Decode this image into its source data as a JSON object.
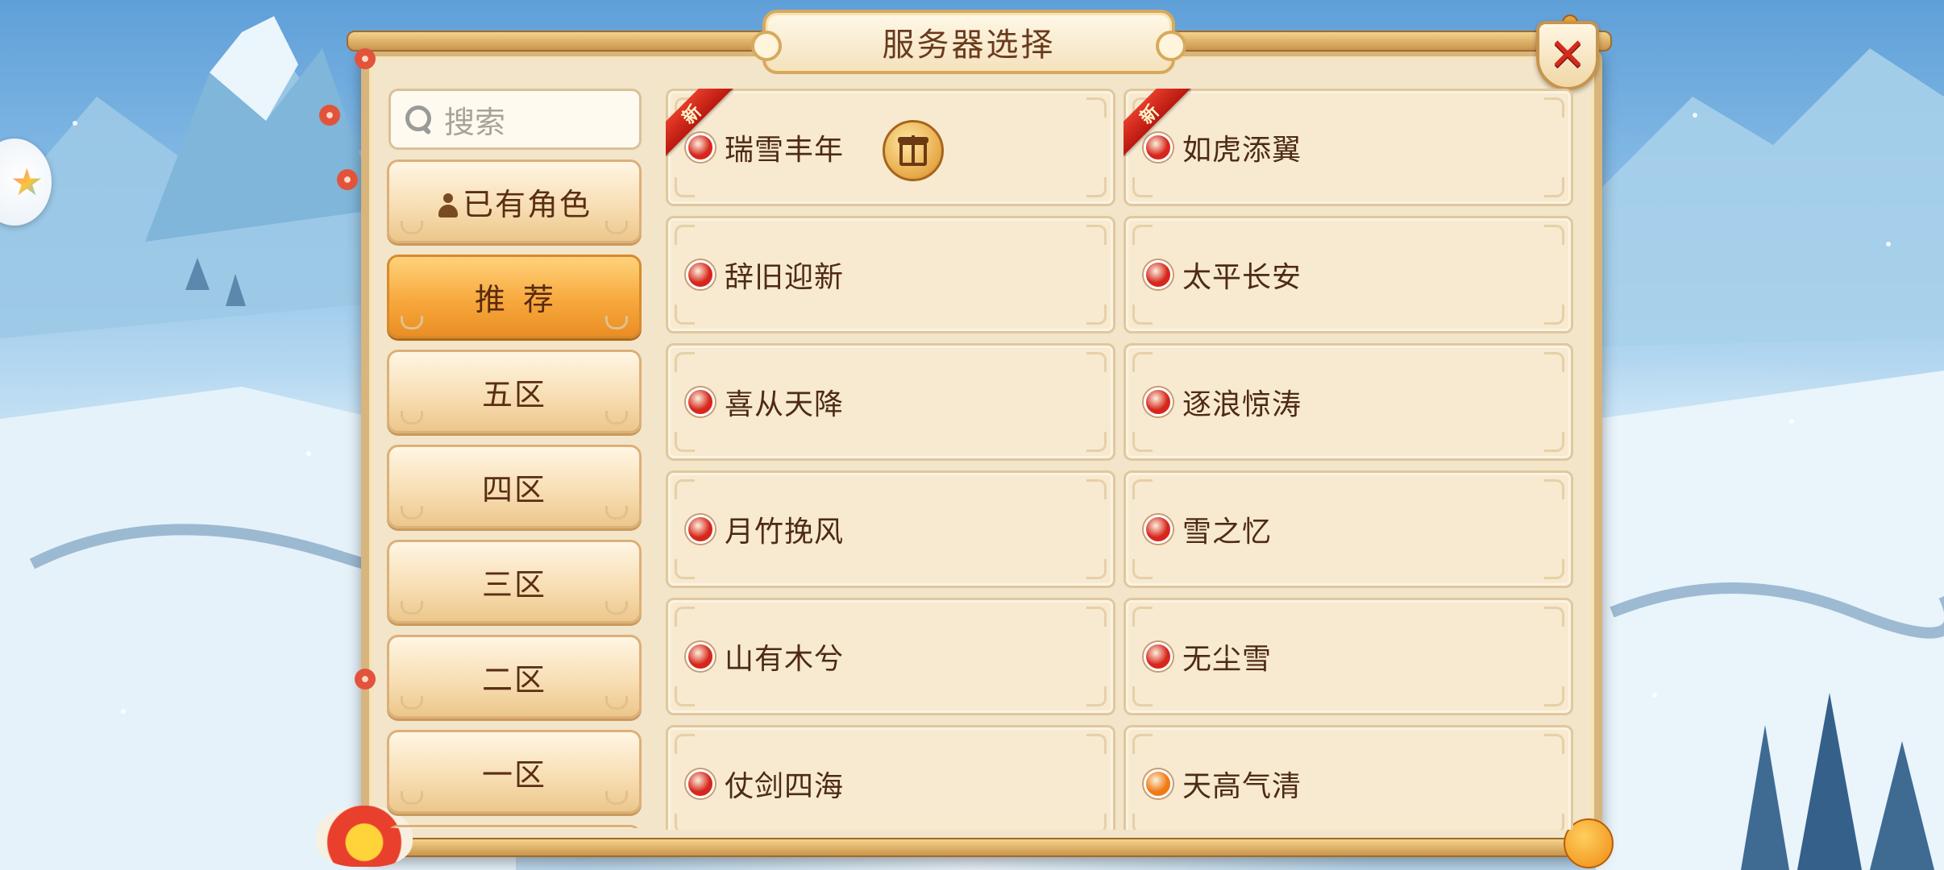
{
  "title": "服务器选择",
  "close_icon": "close-x-icon",
  "search": {
    "placeholder": "搜索",
    "icon": "search-icon"
  },
  "side_tabs": [
    {
      "label": "已有角色",
      "icon": "person-icon",
      "active": false
    },
    {
      "label": "推荐",
      "active": true
    },
    {
      "label": "五区",
      "active": false
    },
    {
      "label": "四区",
      "active": false
    },
    {
      "label": "三区",
      "active": false
    },
    {
      "label": "二区",
      "active": false
    },
    {
      "label": "一区",
      "active": false
    }
  ],
  "new_badge": "新",
  "status_colors": {
    "red": "#d7261b",
    "orange": "#f27a12"
  },
  "servers": [
    {
      "name": "瑞雪丰年",
      "status": "red",
      "is_new": true,
      "has_gift": true
    },
    {
      "name": "如虎添翼",
      "status": "red",
      "is_new": true,
      "has_gift": false
    },
    {
      "name": "辞旧迎新",
      "status": "red",
      "is_new": false,
      "has_gift": false
    },
    {
      "name": "太平长安",
      "status": "red",
      "is_new": false,
      "has_gift": false
    },
    {
      "name": "喜从天降",
      "status": "red",
      "is_new": false,
      "has_gift": false
    },
    {
      "name": "逐浪惊涛",
      "status": "red",
      "is_new": false,
      "has_gift": false
    },
    {
      "name": "月竹挽风",
      "status": "red",
      "is_new": false,
      "has_gift": false
    },
    {
      "name": "雪之忆",
      "status": "red",
      "is_new": false,
      "has_gift": false
    },
    {
      "name": "山有木兮",
      "status": "red",
      "is_new": false,
      "has_gift": false
    },
    {
      "name": "无尘雪",
      "status": "red",
      "is_new": false,
      "has_gift": false
    },
    {
      "name": "仗剑四海",
      "status": "red",
      "is_new": false,
      "has_gift": false
    },
    {
      "name": "天高气清",
      "status": "orange",
      "is_new": false,
      "has_gift": false
    }
  ]
}
